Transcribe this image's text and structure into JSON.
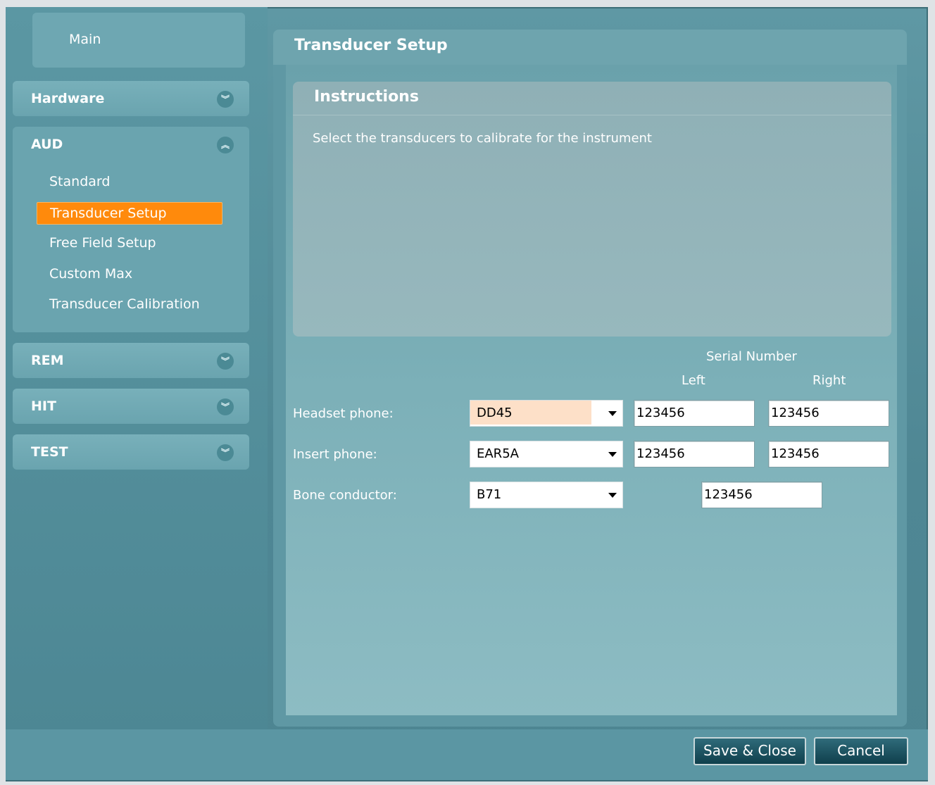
{
  "nav": {
    "main_label": "Main",
    "sections": [
      {
        "label": "Hardware",
        "chevron": "double-chevron-down"
      },
      {
        "label": "AUD",
        "chevron": "double-chevron-up",
        "expanded": true
      },
      {
        "label": "REM",
        "chevron": "double-chevron-down"
      },
      {
        "label": "HIT",
        "chevron": "double-chevron-down"
      },
      {
        "label": "TEST",
        "chevron": "double-chevron-down"
      }
    ],
    "aud_items": [
      {
        "label": "Standard"
      },
      {
        "label": "Transducer Setup",
        "selected": true
      },
      {
        "label": "Free Field Setup"
      },
      {
        "label": "Custom Max"
      },
      {
        "label": "Transducer Calibration"
      }
    ]
  },
  "content": {
    "title": "Transducer Setup",
    "instructions": {
      "title": "Instructions",
      "text": "Select the transducers to calibrate for the instrument"
    },
    "serial_header": "Serial Number",
    "left_header": "Left",
    "right_header": "Right",
    "rows": [
      {
        "label": "Headset phone:",
        "select": "DD45",
        "left": "123456",
        "right": "123456"
      },
      {
        "label": "Insert phone:",
        "select": "EAR5A",
        "left": "123456",
        "right": "123456"
      },
      {
        "label": "Bone conductor:",
        "select": "B71",
        "serial": "123456"
      }
    ]
  },
  "footer": {
    "save_label": "Save & Close",
    "cancel_label": "Cancel"
  },
  "colors": {
    "accent_selected": "#ff8a0c",
    "panel": "#5f98a4"
  }
}
